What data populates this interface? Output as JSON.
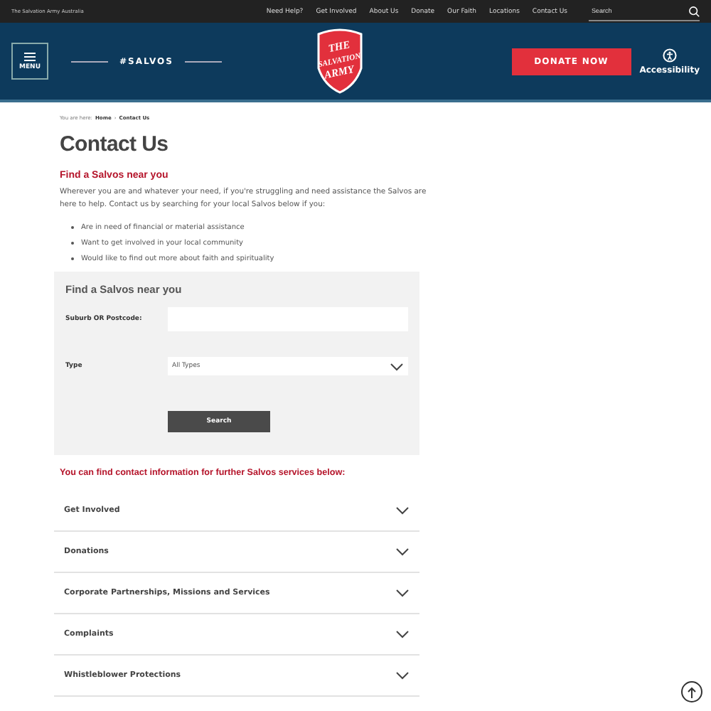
{
  "top_bar": {
    "site_name": "The Salvation Army Australia",
    "links": [
      "Need Help?",
      "Get Involved",
      "About Us",
      "Donate",
      "Our Faith",
      "Locations",
      "Contact Us"
    ],
    "search": {
      "placeholder": "Search"
    }
  },
  "header": {
    "menu_label": "MENU",
    "hashtag": "#SALVOS",
    "logo_lines": [
      "THE",
      "SALVATION",
      "ARMY"
    ],
    "donate_button": "DONATE NOW",
    "accessibility_label": "Accessibility"
  },
  "breadcrumb": {
    "prefix": "You are here:",
    "separator": "›",
    "items": [
      "Home",
      "Contact Us"
    ]
  },
  "page_title": "Contact Us",
  "intro": {
    "heading": "Find a Salvos near you",
    "paragraph": "Wherever you are and whatever your need, if you're struggling and need assistance the Salvos are here to help. Contact us by searching for your local Salvos below if you:",
    "bullets": [
      "Are in need of financial or material assistance",
      "Want to get involved in your local community",
      "Would like to find out more about faith and spirituality"
    ]
  },
  "finder": {
    "title": "Find a Salvos near you",
    "suburb_label": "Suburb OR Postcode:",
    "type_label": "Type",
    "type_value": "All Types",
    "search_button": "Search"
  },
  "services_heading": "You can find contact information for further Salvos services below:",
  "accordion": [
    {
      "label": "Get Involved",
      "expanded": false
    },
    {
      "label": "Donations",
      "expanded": false
    },
    {
      "label": "Corporate Partnerships, Missions and Services",
      "expanded": false
    },
    {
      "label": "Complaints",
      "expanded": false
    },
    {
      "label": "Whistleblower Protections",
      "expanded": false
    }
  ]
}
